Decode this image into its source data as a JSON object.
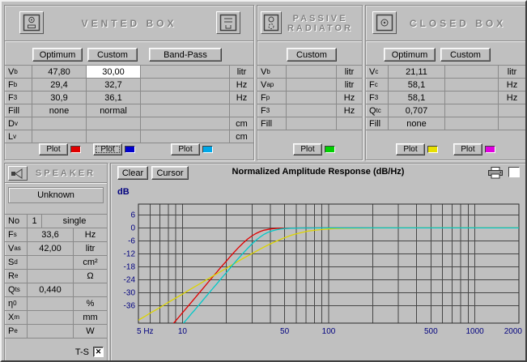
{
  "vented_box": {
    "title": "VENTED BOX",
    "buttons": {
      "optimum": "Optimum",
      "custom": "Custom",
      "bandpass": "Band-Pass"
    },
    "rows": [
      {
        "label": "V_b",
        "c1": "47,80",
        "c2": "30,00",
        "c3": "",
        "unit": "litr"
      },
      {
        "label": "F_b",
        "c1": "29,4",
        "c2": "32,7",
        "c3": "",
        "unit": "Hz"
      },
      {
        "label": "F_3",
        "c1": "30,9",
        "c2": "36,1",
        "c3": "",
        "unit": "Hz"
      },
      {
        "label": "Fill",
        "c1": "none",
        "c2": "normal",
        "c3": "",
        "unit": ""
      },
      {
        "label": "D_v",
        "c1": "",
        "c2": "",
        "c3": "",
        "unit": "cm"
      },
      {
        "label": "L_v",
        "c1": "",
        "c2": "",
        "c3": "",
        "unit": "cm"
      }
    ],
    "plots": [
      {
        "label": "Plot",
        "color": "#e00000"
      },
      {
        "label": "Plot",
        "color": "#0000cc"
      },
      {
        "label": "Plot",
        "color": "#00a8e8"
      }
    ]
  },
  "passive_radiator": {
    "title_line1": "PASSIVE",
    "title_line2": "RADIATOR",
    "buttons": {
      "custom": "Custom"
    },
    "rows": [
      {
        "label": "V_b",
        "c1": "",
        "unit": "litr"
      },
      {
        "label": "V_ap",
        "c1": "",
        "unit": "litr"
      },
      {
        "label": "F_p",
        "c1": "",
        "unit": "Hz"
      },
      {
        "label": "F_3",
        "c1": "",
        "unit": "Hz"
      },
      {
        "label": "Fill",
        "c1": "",
        "unit": ""
      }
    ],
    "plots": [
      {
        "label": "Plot",
        "color": "#00d000"
      }
    ]
  },
  "closed_box": {
    "title": "CLOSED BOX",
    "buttons": {
      "optimum": "Optimum",
      "custom": "Custom"
    },
    "rows": [
      {
        "label": "V_c",
        "c1": "21,11",
        "c2": "",
        "unit": "litr"
      },
      {
        "label": "F_c",
        "c1": "58,1",
        "c2": "",
        "unit": "Hz"
      },
      {
        "label": "F_3",
        "c1": "58,1",
        "c2": "",
        "unit": "Hz"
      },
      {
        "label": "Q_tc",
        "c1": "0,707",
        "c2": "",
        "unit": ""
      },
      {
        "label": "Fill",
        "c1": "none",
        "c2": "",
        "unit": ""
      }
    ],
    "plots": [
      {
        "label": "Plot",
        "color": "#e8e000"
      },
      {
        "label": "Plot",
        "color": "#e000e0"
      }
    ]
  },
  "speaker": {
    "title": "SPEAKER",
    "name": "Unknown",
    "no_row": {
      "label": "No",
      "value": "1",
      "mode": "single"
    },
    "rows": [
      {
        "label": "F_s",
        "value": "33,6",
        "unit": "Hz"
      },
      {
        "label": "V_as",
        "value": "42,00",
        "unit": "litr"
      },
      {
        "label": "S_d",
        "value": "",
        "unit": "cm²"
      },
      {
        "label": "R_e",
        "value": "",
        "unit": "Ω"
      },
      {
        "label": "Q_ts",
        "value": "0,440",
        "unit": ""
      },
      {
        "label": "η_0",
        "value": "",
        "unit": "%"
      },
      {
        "label": "X_m",
        "value": "",
        "unit": "mm"
      },
      {
        "label": "P_e",
        "value": "",
        "unit": "W"
      }
    ],
    "ts_label": "T-S",
    "ts_checked": true,
    "ts_mark": "✕"
  },
  "chart": {
    "clear_label": "Clear",
    "cursor_label": "Cursor",
    "title": "Normalized Amplitude Response (dB/Hz)"
  },
  "chart_data": {
    "type": "line",
    "title": "Normalized Amplitude Response (dB/Hz)",
    "y_label": "dB",
    "log_x": true,
    "grid": true,
    "grid_color": "#464646",
    "axis_label_color": "#00007f",
    "x_range": [
      5,
      2000
    ],
    "y_range": [
      -44,
      11
    ],
    "x_ticks": [
      {
        "f": 5,
        "label": "5 Hz"
      },
      {
        "f": 10,
        "label": "10"
      },
      {
        "f": 50,
        "label": "50"
      },
      {
        "f": 100,
        "label": "100"
      },
      {
        "f": 500,
        "label": "500"
      },
      {
        "f": 1000,
        "label": "1000"
      },
      {
        "f": 2000,
        "label": "2000"
      }
    ],
    "y_ticks": [
      6,
      0,
      -6,
      -12,
      -18,
      -24,
      -30,
      -36
    ],
    "series": [
      {
        "name": "vented-box-optimum",
        "color": "#e00000",
        "points": [
          [
            8.5,
            -44.8
          ],
          [
            9,
            -42.9
          ],
          [
            9.5,
            -41
          ],
          [
            10,
            -39.2
          ],
          [
            11,
            -35.9
          ],
          [
            12,
            -32.9
          ],
          [
            13,
            -30.1
          ],
          [
            14,
            -27.5
          ],
          [
            15,
            -25.1
          ],
          [
            16,
            -22.9
          ],
          [
            17,
            -20.8
          ],
          [
            18,
            -18.8
          ],
          [
            19,
            -17
          ],
          [
            20,
            -15.3
          ],
          [
            21,
            -13.6
          ],
          [
            22,
            -12.1
          ],
          [
            24,
            -9.3
          ],
          [
            26,
            -7
          ],
          [
            28,
            -5.1
          ],
          [
            30,
            -3.6
          ],
          [
            32,
            -2.5
          ],
          [
            34,
            -1.7
          ],
          [
            36,
            -1.1
          ],
          [
            40,
            -0.5
          ],
          [
            45,
            -0.2
          ],
          [
            50,
            -0.1
          ],
          [
            60,
            -0.05
          ],
          [
            80,
            0
          ],
          [
            120,
            0
          ],
          [
            300,
            0
          ],
          [
            800,
            0
          ],
          [
            2000,
            0
          ]
        ]
      },
      {
        "name": "closed-box-optimum",
        "color": "#ddd400",
        "points": [
          [
            5,
            -42.6
          ],
          [
            5.5,
            -41
          ],
          [
            6,
            -39.4
          ],
          [
            6.5,
            -38.1
          ],
          [
            7,
            -36.8
          ],
          [
            7.5,
            -35.6
          ],
          [
            8,
            -34.4
          ],
          [
            9,
            -32.4
          ],
          [
            10,
            -30.6
          ],
          [
            11,
            -28.9
          ],
          [
            12,
            -27.4
          ],
          [
            13,
            -26
          ],
          [
            14,
            -24.7
          ],
          [
            16,
            -22.4
          ],
          [
            18,
            -20.4
          ],
          [
            20,
            -18.6
          ],
          [
            23,
            -16.2
          ],
          [
            26,
            -14.1
          ],
          [
            30,
            -11.8
          ],
          [
            34,
            -9.8
          ],
          [
            38,
            -8.1
          ],
          [
            43,
            -6.4
          ],
          [
            48,
            -5
          ],
          [
            54,
            -3.7
          ],
          [
            58.1,
            -3
          ],
          [
            64,
            -2.3
          ],
          [
            72,
            -1.5
          ],
          [
            82,
            -1
          ],
          [
            95,
            -0.6
          ],
          [
            110,
            -0.3
          ],
          [
            130,
            -0.2
          ],
          [
            160,
            -0.1
          ],
          [
            200,
            -0.05
          ],
          [
            300,
            0
          ],
          [
            600,
            0
          ],
          [
            1200,
            0
          ],
          [
            2000,
            0
          ]
        ]
      },
      {
        "name": "vented-box-custom",
        "color": "#00c8c8",
        "points": [
          [
            10,
            -44.6
          ],
          [
            10.5,
            -42.9
          ],
          [
            11,
            -41.3
          ],
          [
            11.5,
            -39.7
          ],
          [
            12,
            -38.3
          ],
          [
            13,
            -35.5
          ],
          [
            14,
            -32.9
          ],
          [
            15,
            -30.5
          ],
          [
            16,
            -28.3
          ],
          [
            17,
            -26.2
          ],
          [
            18,
            -24.2
          ],
          [
            19,
            -22.3
          ],
          [
            20,
            -20.6
          ],
          [
            21,
            -18.9
          ],
          [
            22,
            -17.3
          ],
          [
            24,
            -14.3
          ],
          [
            26,
            -11.7
          ],
          [
            28,
            -9.4
          ],
          [
            30,
            -7.3
          ],
          [
            32,
            -5.6
          ],
          [
            34,
            -4.2
          ],
          [
            36.1,
            -3
          ],
          [
            38,
            -2.2
          ],
          [
            40,
            -1.6
          ],
          [
            43,
            -1
          ],
          [
            46,
            -0.6
          ],
          [
            50,
            -0.3
          ],
          [
            55,
            -0.15
          ],
          [
            65,
            -0.05
          ],
          [
            90,
            0
          ],
          [
            200,
            0
          ],
          [
            600,
            0
          ],
          [
            2000,
            0
          ]
        ]
      }
    ]
  }
}
